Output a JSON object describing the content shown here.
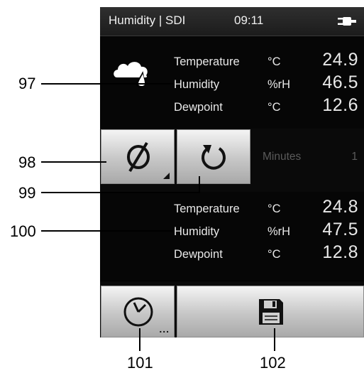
{
  "status_bar": {
    "title": "Humidity | SDI",
    "time": "09:11",
    "power_icon": "plug-icon"
  },
  "current": {
    "icon": "cloud-drop-icon",
    "rows": [
      {
        "name": "Temperature",
        "unit": "°C",
        "value": "24.9"
      },
      {
        "name": "Humidity",
        "unit": "%rH",
        "value": "46.5"
      },
      {
        "name": "Dewpoint",
        "unit": "°C",
        "value": "12.6"
      }
    ]
  },
  "controls": {
    "null_button_icon": "empty-set-icon",
    "refresh_button_icon": "refresh-icon",
    "minutes_label": "Minutes",
    "minutes_value": "1"
  },
  "reference": {
    "rows": [
      {
        "name": "Temperature",
        "unit": "°C",
        "value": "24.8"
      },
      {
        "name": "Humidity",
        "unit": "%rH",
        "value": "47.5"
      },
      {
        "name": "Dewpoint",
        "unit": "°C",
        "value": "12.8"
      }
    ]
  },
  "toolbar": {
    "timer_button_icon": "clock-icon",
    "timer_more": "...",
    "save_button_icon": "floppy-disk-icon"
  },
  "callouts": {
    "c97": "97",
    "c98": "98",
    "c99": "99",
    "c100": "100",
    "c101": "101",
    "c102": "102"
  },
  "colors": {
    "screen_bg": "#000000",
    "text": "#e8e8e8",
    "disabled_text": "#5a5a5a",
    "button_face": "#c6c6c6"
  }
}
